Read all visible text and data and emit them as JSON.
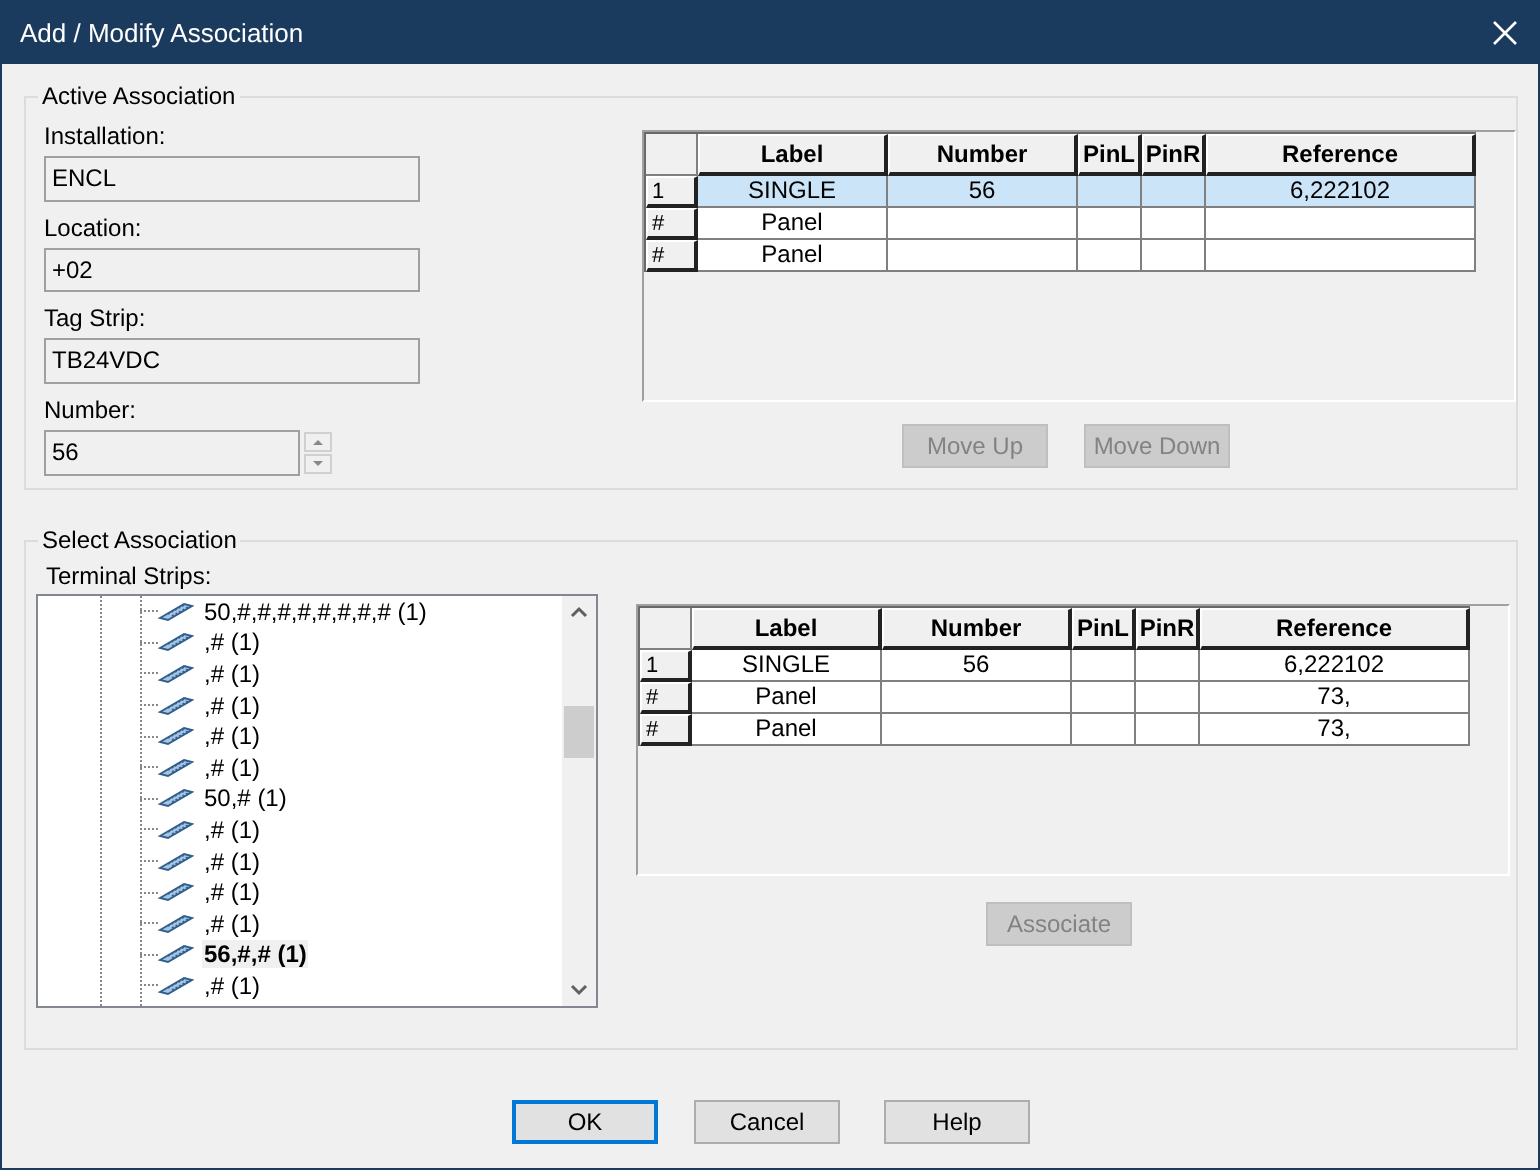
{
  "window": {
    "title": "Add / Modify Association"
  },
  "active_association": {
    "title": "Active Association",
    "fields": [
      {
        "label": "Installation:",
        "value": "ENCL"
      },
      {
        "label": "Location:",
        "value": "+02"
      },
      {
        "label": "Tag Strip:",
        "value": "TB24VDC"
      }
    ],
    "number": {
      "label": "Number:",
      "value": "56"
    },
    "grid": {
      "columns": [
        "Label",
        "Number",
        "PinL",
        "PinR",
        "Reference"
      ],
      "rows": [
        {
          "header": "1",
          "cells": [
            "SINGLE",
            "56",
            "",
            "",
            "6,222102"
          ],
          "selected": true
        },
        {
          "header": "#",
          "cells": [
            "Panel",
            "",
            "",
            "",
            ""
          ],
          "selected": false
        },
        {
          "header": "#",
          "cells": [
            "Panel",
            "",
            "",
            "",
            ""
          ],
          "selected": false
        }
      ]
    },
    "buttons": [
      {
        "label": "Move Up",
        "disabled": true
      },
      {
        "label": "Move Down",
        "disabled": true
      }
    ]
  },
  "select_association": {
    "title": "Select Association",
    "tree_label": "Terminal Strips:",
    "tree": [
      {
        "label": "50,#,#,#,#,#,#,#,# (1)",
        "selected": false
      },
      {
        "label": ",# (1)",
        "selected": false
      },
      {
        "label": ",# (1)",
        "selected": false
      },
      {
        "label": ",# (1)",
        "selected": false
      },
      {
        "label": ",# (1)",
        "selected": false
      },
      {
        "label": ",# (1)",
        "selected": false
      },
      {
        "label": "50,# (1)",
        "selected": false
      },
      {
        "label": ",# (1)",
        "selected": false
      },
      {
        "label": ",# (1)",
        "selected": false
      },
      {
        "label": ",# (1)",
        "selected": false
      },
      {
        "label": ",# (1)",
        "selected": false
      },
      {
        "label": "56,#,# (1)",
        "selected": true
      },
      {
        "label": ",# (1)",
        "selected": false
      }
    ],
    "grid": {
      "columns": [
        "Label",
        "Number",
        "PinL",
        "PinR",
        "Reference"
      ],
      "rows": [
        {
          "header": "1",
          "cells": [
            "SINGLE",
            "56",
            "",
            "",
            "6,222102"
          ],
          "selected": false
        },
        {
          "header": "#",
          "cells": [
            "Panel",
            "",
            "",
            "",
            "73,"
          ],
          "selected": false
        },
        {
          "header": "#",
          "cells": [
            "Panel",
            "",
            "",
            "",
            "73,"
          ],
          "selected": false
        }
      ]
    },
    "buttons": [
      {
        "label": "Associate",
        "disabled": true
      }
    ]
  },
  "buttons": [
    {
      "label": "OK",
      "default": true
    },
    {
      "label": "Cancel",
      "default": false
    },
    {
      "label": "Help",
      "default": false
    }
  ]
}
